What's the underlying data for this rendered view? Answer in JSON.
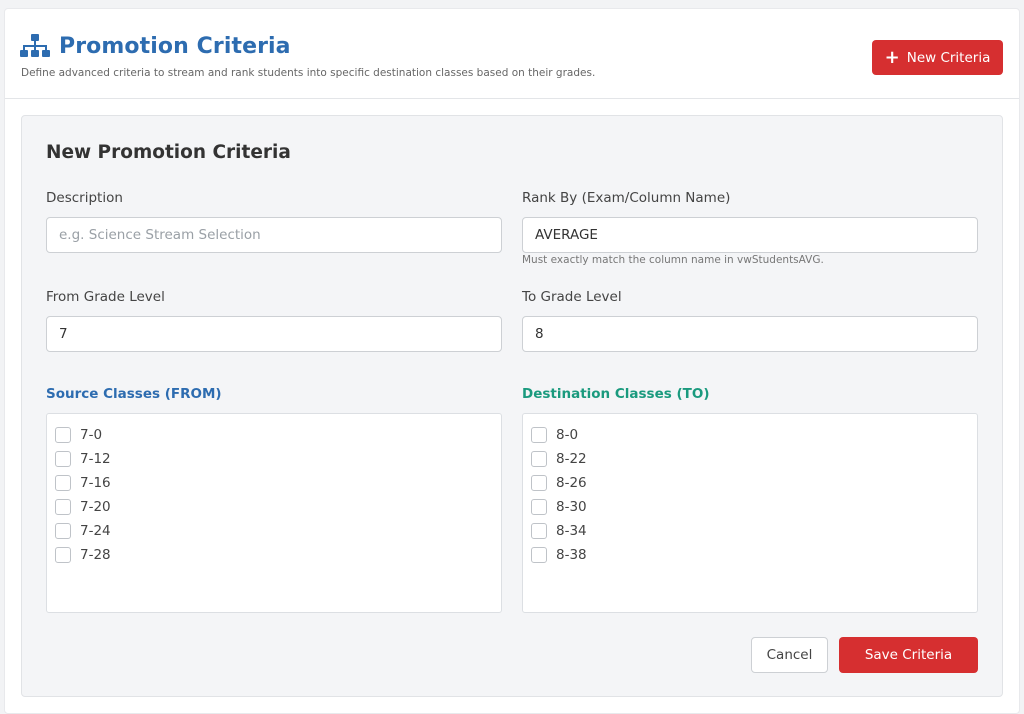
{
  "header": {
    "icon": "sitemap-icon",
    "title": "Promotion Criteria",
    "subtitle": "Define advanced criteria to stream and rank students into specific destination classes based on their grades.",
    "new_button": {
      "icon": "plus-icon",
      "icon_glyph": "+",
      "label": "New Criteria"
    }
  },
  "form": {
    "title": "New Promotion Criteria",
    "description": {
      "label": "Description",
      "value": "",
      "placeholder": "e.g. Science Stream Selection"
    },
    "rank_by": {
      "label": "Rank By (Exam/Column Name)",
      "value": "AVERAGE",
      "hint": "Must exactly match the column name in vwStudentsAVG."
    },
    "from_grade": {
      "label": "From Grade Level",
      "value": "7"
    },
    "to_grade": {
      "label": "To Grade Level",
      "value": "8"
    },
    "source_classes": {
      "label": "Source Classes (FROM)",
      "items": [
        "7-0",
        "7-12",
        "7-16",
        "7-20",
        "7-24",
        "7-28"
      ]
    },
    "destination_classes": {
      "label": "Destination Classes (TO)",
      "items": [
        "8-0",
        "8-22",
        "8-26",
        "8-30",
        "8-34",
        "8-38"
      ]
    },
    "cancel_label": "Cancel",
    "save_label": "Save Criteria"
  },
  "colors": {
    "brand_blue": "#2d6cb0",
    "accent_red": "#d62f30",
    "destination_green": "#1a9a7e"
  }
}
